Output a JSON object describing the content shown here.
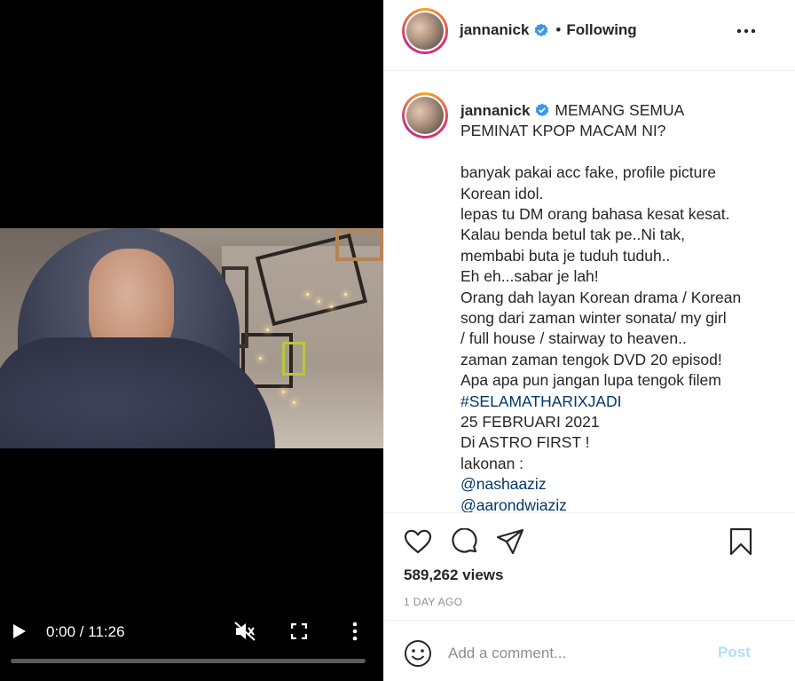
{
  "video": {
    "time_display": "0:00 / 11:26",
    "progress_fraction": 0.0,
    "muted": true
  },
  "header": {
    "username": "jannanick",
    "separator": "•",
    "follow_status": "Following"
  },
  "caption": {
    "username": "jannanick",
    "title_lines": [
      "MEMANG SEMUA",
      "PEMINAT KPOP MACAM NI?"
    ],
    "lines": [
      "banyak pakai acc fake, profile picture",
      "Korean idol.",
      "lepas tu DM orang bahasa kesat kesat.",
      "Kalau benda betul tak pe..Ni tak,",
      "membabi buta je tuduh tuduh..",
      "Eh eh...sabar je lah!",
      "Orang dah layan Korean drama / Korean",
      "song dari zaman winter sonata/ my girl",
      "/ full house / stairway to heaven..",
      "zaman zaman tengok DVD 20 episod!",
      "Apa apa pun jangan lupa tengok filem"
    ],
    "hashtag": "#SELAMATHARIXJADI",
    "lines_after": [
      "25 FEBRUARI 2021",
      "Di ASTRO FIRST !",
      "lakonan :"
    ],
    "mentions": [
      "@nashaaziz",
      "@aarondwiaziz"
    ]
  },
  "stats": {
    "views": "589,262 views",
    "posted": "1 DAY AGO"
  },
  "comment": {
    "placeholder": "Add a comment...",
    "post_label": "Post"
  },
  "colors": {
    "link": "#00376b",
    "verified": "#3897f0",
    "post_disabled": "#b2dffc"
  }
}
